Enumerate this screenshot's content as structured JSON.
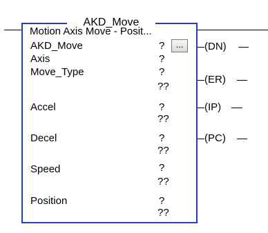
{
  "block": {
    "title": "AKD_Move",
    "subtitle": "Motion Axis Move - Posit...",
    "rows": [
      {
        "name": "AKD_Move",
        "value": "?"
      },
      {
        "name": "Axis",
        "value": "?"
      },
      {
        "name": "Move_Type",
        "value": "?",
        "sub": "??"
      },
      {
        "name": "Accel",
        "value": "?",
        "sub": "??"
      },
      {
        "name": "Decel",
        "value": "?",
        "sub": "??"
      },
      {
        "name": "Speed",
        "value": "?",
        "sub": "??"
      },
      {
        "name": "Position",
        "value": "?",
        "sub": "??"
      }
    ],
    "browse_button_label": "..."
  },
  "outputs": {
    "dn": "(DN)",
    "er": "(ER)",
    "ip": "(IP)",
    "pc": "(PC)"
  },
  "colors": {
    "block_border": "#1f3fb6",
    "rung": "#000000"
  }
}
